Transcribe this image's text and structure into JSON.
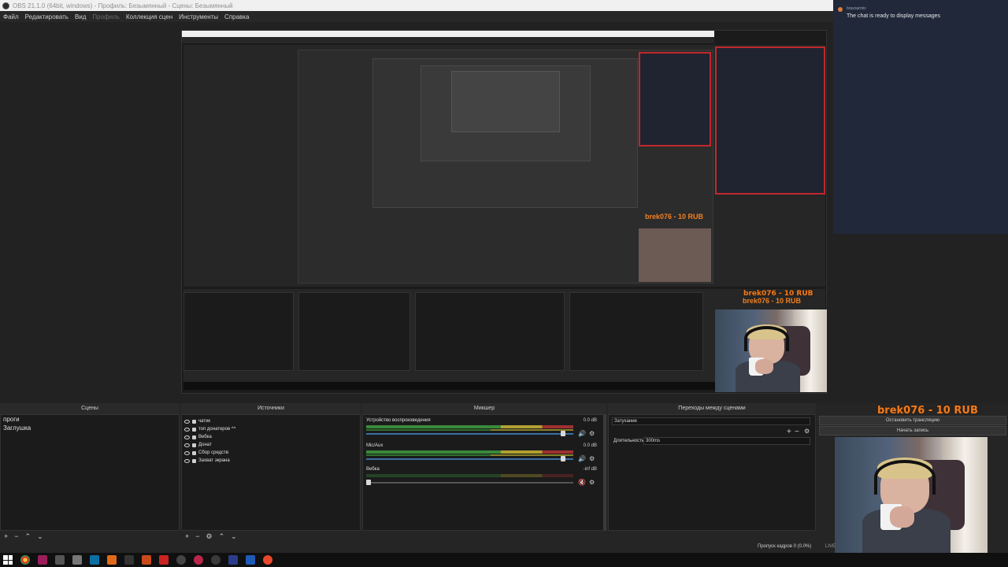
{
  "window": {
    "title": "OBS 21.1.0 (64bit, windows) - Профиль: Безымянный - Сцены: Безымянный"
  },
  "menu": {
    "items": [
      "Файл",
      "Редактировать",
      "Вид",
      "Профиль",
      "Коллекция сцен",
      "Инструменты",
      "Справка"
    ]
  },
  "chat": {
    "user": "bravoarmix",
    "message": "The chat is ready to display messages"
  },
  "scenes": {
    "header": "Сцены",
    "items": [
      "проги",
      "Заглушка"
    ]
  },
  "sources": {
    "header": "Источники",
    "items": [
      "чатик",
      "топ донатеров ^^",
      "Вебка",
      "Донат",
      "Сбор средств",
      "Захват экрана"
    ]
  },
  "mixer": {
    "header": "Микшер",
    "channels": [
      {
        "name": "Устройство воспроизведения",
        "db": "0.0 dB",
        "level": 0.96,
        "muted": false
      },
      {
        "name": "Mic/Aux",
        "db": "0.0 dB",
        "level": 0.96,
        "muted": false
      },
      {
        "name": "Вебка",
        "db": "-inf dB",
        "level": 0.0,
        "muted": true
      }
    ]
  },
  "transitions": {
    "header": "Переходы между сценами",
    "selected": "Затухание",
    "duration_label": "Длительность",
    "duration_value": "300ms"
  },
  "controls": {
    "donation": "brek076 - 10 RUB",
    "stop_stream": "Остановить трансляцию",
    "start_record": "Начать запись"
  },
  "status": {
    "dropped": "Пропуск кадров 0 (0.0%)",
    "live": "LIVE"
  },
  "colors": {
    "accent_orange": "#f07a1e",
    "chat_bg": "#20283a",
    "selection_red": "#c0282c",
    "slider_blue": "#3b6ea5"
  }
}
